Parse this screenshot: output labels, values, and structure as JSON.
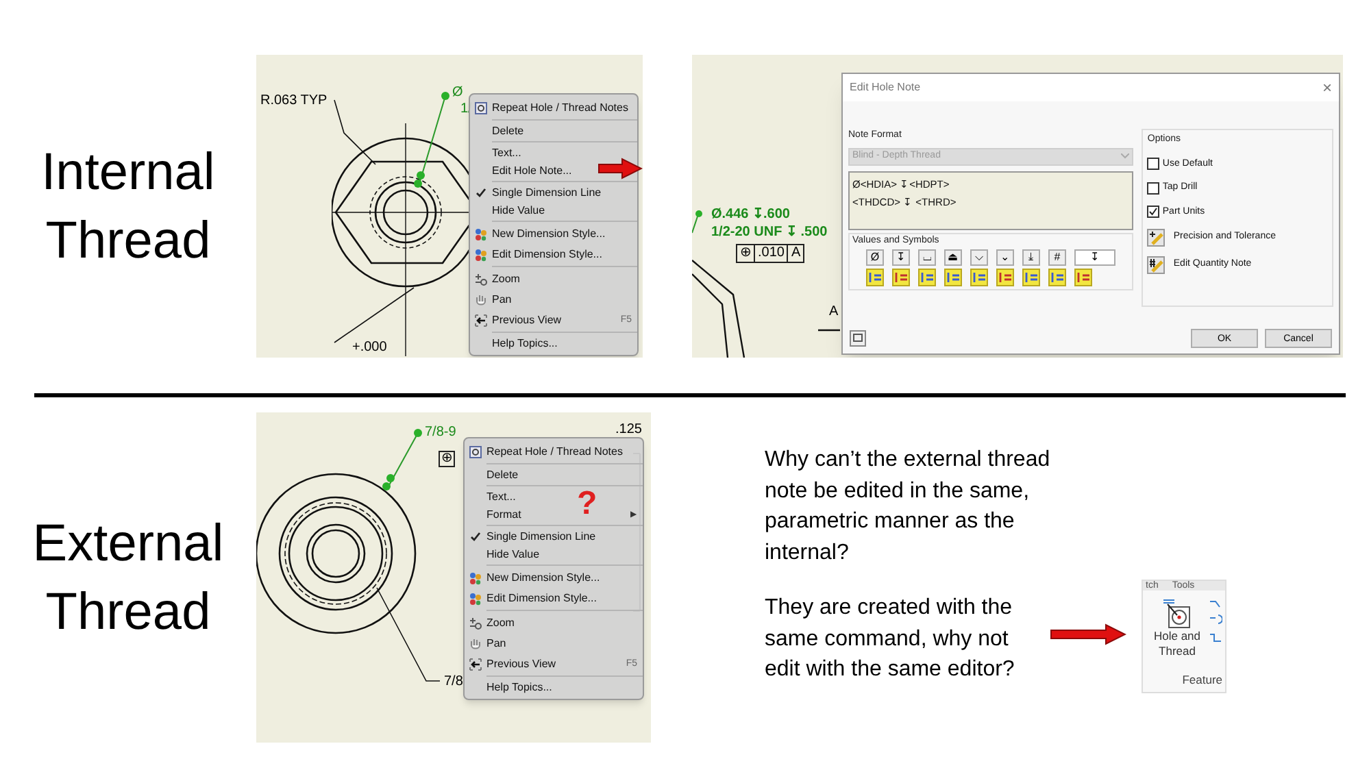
{
  "internal": {
    "label": "Internal Thread",
    "drawing": {
      "labels": [
        "R.063 TYP",
        "Ø",
        "1/",
        "+.000"
      ]
    },
    "menu": [
      [
        {
          "label": "Repeat Hole / Thread Notes",
          "kind": "repeat",
          "checked": false
        }
      ],
      [
        {
          "label": "Delete",
          "kind": "plain",
          "checked": false
        }
      ],
      [
        {
          "label": "Text...",
          "kind": "plain",
          "checked": false
        },
        {
          "label": "Edit Hole Note...",
          "kind": "plain",
          "checked": false
        }
      ],
      [
        {
          "label": "Single Dimension Line",
          "kind": "plain",
          "checked": true
        },
        {
          "label": "Hide Value",
          "kind": "plain",
          "checked": false
        }
      ],
      [
        {
          "label": "New Dimension Style...",
          "kind": "style",
          "checked": false
        },
        {
          "label": "Edit Dimension Style...",
          "kind": "style",
          "checked": false
        }
      ],
      [
        {
          "label": "Zoom",
          "kind": "zoom",
          "checked": false
        },
        {
          "label": "Pan",
          "kind": "pan",
          "checked": false
        },
        {
          "label": "Previous View",
          "kind": "back",
          "checked": false,
          "shortcut": "F5"
        }
      ],
      [
        {
          "label": "Help Topics...",
          "kind": "plain",
          "checked": false
        }
      ]
    ],
    "note_drawing": {
      "lines": [
        "Ø.446 ↧.600",
        "1/2-20 UNF ↧ .500"
      ],
      "frame": [
        "⊕",
        ".010",
        "A"
      ],
      "datum": "A"
    },
    "dialog": {
      "title": "Edit Hole Note",
      "close": "×",
      "note_format_label": "Note Format",
      "format": {
        "value": "Blind - Depth Thread",
        "disabled": true
      },
      "note_lines": [
        "Ø<HDIA> ↧<HDPT>",
        "<THDCD> ↧ <THRD>"
      ],
      "symbols_label": "Values and Symbols",
      "symbols": [
        "Ø",
        "↧",
        "⌴",
        "⏏",
        "⌵",
        "⌄",
        "⤓",
        "#"
      ],
      "symbol_dropdown": "↧",
      "options_label": "Options",
      "options": [
        {
          "label": "Use Default",
          "checked": false
        },
        {
          "label": "Tap Drill",
          "checked": false
        },
        {
          "label": "Part Units",
          "checked": true
        }
      ],
      "actions": [
        "Precision and Tolerance",
        "Edit Quantity Note"
      ],
      "buttons": [
        "OK",
        "Cancel"
      ]
    }
  },
  "external": {
    "label": "External Thread",
    "drawing": {
      "labels": [
        "7/8-9",
        ".125",
        "⊕",
        "7/8"
      ]
    },
    "menu": [
      [
        {
          "label": "Repeat Hole / Thread Notes",
          "kind": "repeat",
          "checked": false
        }
      ],
      [
        {
          "label": "Delete",
          "kind": "plain",
          "checked": false
        }
      ],
      [
        {
          "label": "Text...",
          "kind": "plain",
          "checked": false
        },
        {
          "label": "Format",
          "kind": "plain",
          "checked": false,
          "arrow": "▶"
        }
      ],
      [
        {
          "label": "Single Dimension Line",
          "kind": "plain",
          "checked": true
        },
        {
          "label": "Hide Value",
          "kind": "plain",
          "checked": false
        }
      ],
      [
        {
          "label": "New Dimension Style...",
          "kind": "style",
          "checked": false
        },
        {
          "label": "Edit Dimension Style...",
          "kind": "style",
          "checked": false
        }
      ],
      [
        {
          "label": "Zoom",
          "kind": "zoom",
          "checked": false
        },
        {
          "label": "Pan",
          "kind": "pan",
          "checked": false
        },
        {
          "label": "Previous View",
          "kind": "back",
          "checked": false,
          "shortcut": "F5"
        }
      ],
      [
        {
          "label": "Help Topics...",
          "kind": "plain",
          "checked": false
        }
      ]
    ],
    "question_mark": "?"
  },
  "question": {
    "paragraphs": [
      "Why can’t the external thread note be edited in the same, parametric manner as the internal?",
      "They are created with the same command, why not edit with the same editor?"
    ]
  },
  "ribbon": {
    "tabs": [
      "tch",
      "Tools"
    ],
    "button": "Hole and Thread",
    "group": "Feature"
  }
}
